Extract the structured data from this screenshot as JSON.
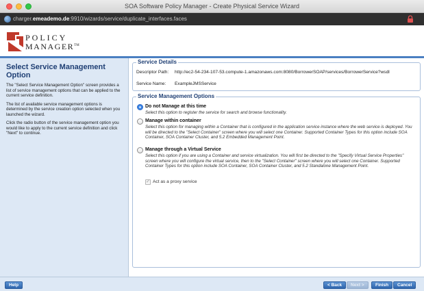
{
  "window": {
    "title": "SOA Software Policy Manager - Create Physical Service Wizard"
  },
  "address_bar": {
    "url_prefix": "charger.",
    "url_host": "emeademo.de",
    "url_suffix": ":9910/wizards/service/duplicate_interfaces.faces"
  },
  "logo": {
    "line1": "POLICY",
    "line2": "MANAGER",
    "trademark": "TM",
    "brand_color": "#c0392b"
  },
  "sidebar": {
    "title": "Select Service Management Option",
    "paragraphs": [
      "The \"Select Service Management Option\" screen provides a list of service management options that can be applied to the current service definition.",
      "The list of available service management options is determined by the service creation option selected when you launched the wizard.",
      "Click the radio button of the service management option you would like to apply to the current service definition and click \"Next\" to continue."
    ]
  },
  "service_details": {
    "legend": "Service Details",
    "descriptor_label": "Descriptor Path:",
    "descriptor_value": "http://ec2-54-234-107-53.compute-1.amazonaws.com:8080/BorrowerSOAP/services/BorrowerService?wsdl",
    "name_label": "Service Name:",
    "name_value": "ExampleJMSService"
  },
  "management_options": {
    "legend": "Service Management Options",
    "selected_index": 0,
    "options": [
      {
        "title": "Do not Manage at this time",
        "description": "Select this option to register the service for search and browse functionality."
      },
      {
        "title": "Manage within container",
        "description": "Select this option for managing within a Container that is configured in the application service instance where the web service is deployed. You will be directed to the \"Select Container\" screen where you will select one Container. Supported Container Types for this option include SOA Container, SOA Container Cluster, and 5.2 Embedded Management Point."
      },
      {
        "title": "Manage through a Virtual Service",
        "description": "Select this option if you are using a Container and service virtualization. You will first be directed to the \"Specify Virtual Service Properties\" screen where you will configure the virtual service, then to the \"Select Container\" screen where you will select one Container. Supported Container Types for this option include SOA Container, SOA Container Cluster, and 5.2 Standalone Management Point."
      }
    ],
    "proxy_checkbox": {
      "label": "Act as a proxy service",
      "checked": true,
      "disabled": true
    }
  },
  "footer": {
    "help": "Help",
    "back": "< Back",
    "next": "Next >",
    "finish": "Finish",
    "cancel": "Cancel"
  },
  "colors": {
    "accent": "#4a7fc1",
    "sidebar_bg": "#dde8f5",
    "heading": "#1f3f74",
    "button": "#3a74bd"
  }
}
